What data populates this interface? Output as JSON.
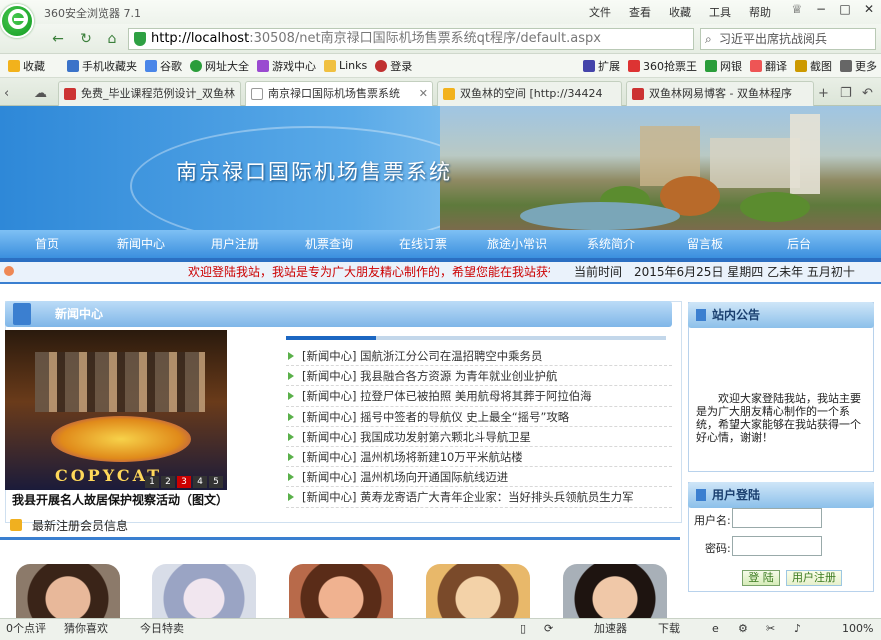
{
  "browser": {
    "title": "360安全浏览器 7.1",
    "menu": [
      "文件",
      "查看",
      "收藏",
      "工具",
      "帮助"
    ],
    "url_host": "http://localhost",
    "url_rest": ":30508/net南京禄口国际机场售票系统qt程序/default.aspx",
    "search_text": "习近平出席抗战阅兵",
    "bookmarks": [
      "收藏",
      "手机收藏夹",
      "谷歌",
      "网址大全",
      "游戏中心",
      "Links",
      "登录"
    ],
    "bookmarks_right": [
      "扩展",
      "360抢票王",
      "网银",
      "翻译",
      "截图",
      "更多"
    ],
    "tabs": [
      {
        "label": "免费_毕业课程范例设计_双鱼林",
        "active": false
      },
      {
        "label": "南京禄口国际机场售票系统",
        "active": true
      },
      {
        "label": "双鱼林的空间 [http://34424",
        "active": false
      },
      {
        "label": "双鱼林网易博客 - 双鱼林程序",
        "active": false
      }
    ]
  },
  "site": {
    "banner_title": "南京禄口国际机场售票系统",
    "nav": [
      "首页",
      "新闻中心",
      "用户注册",
      "机票查询",
      "在线订票",
      "旅途小常识",
      "系统简介",
      "留言板",
      "后台"
    ],
    "marquee": "欢迎登陆我站，我站是专为广大朋友精心制作的，希望您能在我站获得",
    "time_label": "当前时间",
    "time_value": "2015年6月25日 星期四 乙未年 五月初十"
  },
  "news": {
    "title": "新闻中心",
    "caption": "我县开展名人故居保护视察活动（图文）",
    "poster_text": "COPYCAT",
    "pager": [
      "1",
      "2",
      "3",
      "4",
      "5"
    ],
    "items": [
      {
        "cat": "[新闻中心]",
        "text": "国航浙江分公司在温招聘空中乘务员"
      },
      {
        "cat": "[新闻中心]",
        "text": "我县融合各方资源 为青年就业创业护航"
      },
      {
        "cat": "[新闻中心]",
        "text": "拉登尸体已被拍照 美用航母将其葬于阿拉伯海"
      },
      {
        "cat": "[新闻中心]",
        "text": "摇号中签者的导航仪 史上最全“摇号”攻略"
      },
      {
        "cat": "[新闻中心]",
        "text": "我国成功发射第六颗北斗导航卫星"
      },
      {
        "cat": "[新闻中心]",
        "text": "温州机场将新建10万平米航站楼"
      },
      {
        "cat": "[新闻中心]",
        "text": "温州机场向开通国际航线迈进"
      },
      {
        "cat": "[新闻中心]",
        "text": "黄寿龙寄语广大青年企业家：当好排头兵领航员生力军"
      }
    ]
  },
  "members": {
    "title": "最新注册会员信息"
  },
  "notice": {
    "title": "站内公告",
    "text": "欢迎大家登陆我站，我站主要是为广大朋友精心制作的一个系统，希望大家能够在我站获得一个好心情，谢谢！"
  },
  "login": {
    "title": "用户登陆",
    "username_label": "用户名:",
    "password_label": "密码:",
    "login_button": "登 陆",
    "register_button": "用户注册"
  },
  "statusbar": {
    "left": [
      "0个点评",
      "猜你喜欢",
      "今日特卖"
    ],
    "right": [
      "加速器",
      "下载",
      "100%"
    ]
  },
  "colors": {
    "nav_blue": "#3b8fde",
    "marquee_red": "#cc0000",
    "accent_green": "#2ea043"
  }
}
